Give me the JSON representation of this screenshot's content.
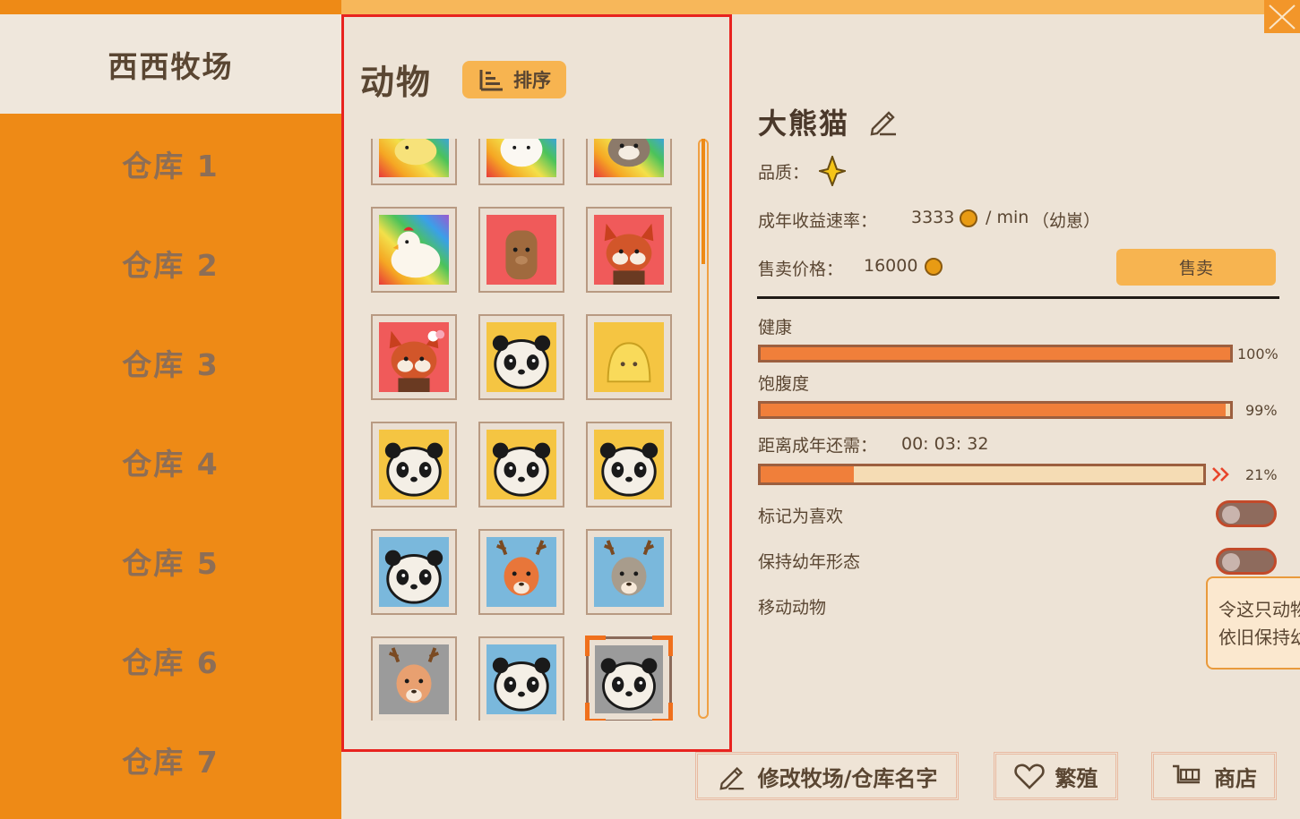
{
  "sidebar": {
    "ranch_name": "西西牧场",
    "warehouses": [
      "仓库 1",
      "仓库 2",
      "仓库 3",
      "仓库 4",
      "仓库 5",
      "仓库 6",
      "仓库 7"
    ]
  },
  "animals_panel": {
    "title": "动物",
    "sort_label": "排序",
    "grid": [
      [
        "rainbow-bird",
        "rainbow-white-animal",
        "rainbow-raccoon"
      ],
      [
        "rainbow-chicken",
        "alpaca",
        "red-panda"
      ],
      [
        "red-panda-with-bow",
        "panda",
        "yellow-slime"
      ],
      [
        "panda",
        "panda",
        "panda"
      ],
      [
        "panda-blue",
        "deer-blue",
        "gray-deer-blue"
      ],
      [
        "deer-gray",
        "panda-blue",
        "panda-gray-selected"
      ]
    ]
  },
  "detail": {
    "name": "大熊猫",
    "quality_label": "品质：",
    "rate_label": "成年收益速率：",
    "rate_value": "3333",
    "rate_unit": "/ min",
    "rate_note": "（幼崽）",
    "price_label": "售卖价格：",
    "price_value": "16000",
    "sell_label": "售卖",
    "health_label": "健康",
    "health_value": 100,
    "health_pct": "100%",
    "fullness_label": "饱腹度",
    "fullness_value": 99,
    "fullness_pct": "99%",
    "adult_label": "距离成年还需：",
    "adult_time": "00: 03: 32",
    "adult_value": 21,
    "adult_pct": "21%",
    "favorite_label": "标记为喜欢",
    "keep_young_label": "保持幼年形态",
    "move_label": "移动动物",
    "tooltip_line1": "令这只动物",
    "tooltip_line2": "依旧保持幼"
  },
  "bottom": {
    "rename_label": "修改牧场/仓库名字",
    "breed_label": "繁殖",
    "shop_label": "商店"
  },
  "colors": {
    "accent": "#ee8a16",
    "highlight_border": "#e8231f",
    "bar_fill": "#f07f3a"
  }
}
